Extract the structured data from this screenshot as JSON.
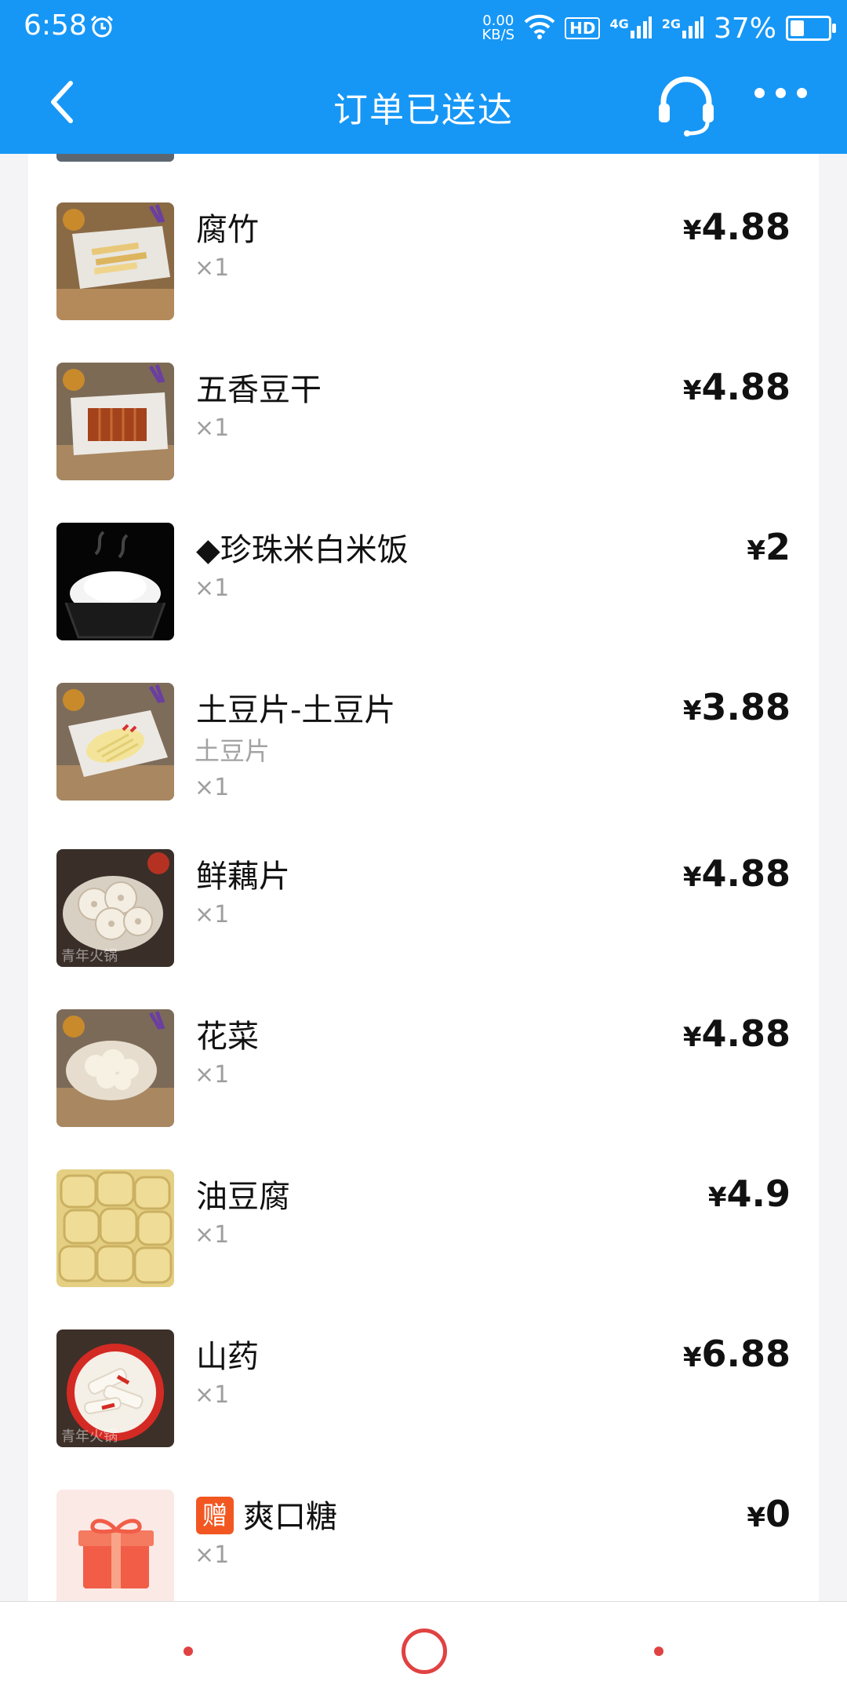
{
  "status": {
    "time": "6:58",
    "net_speed": "0.00",
    "net_unit": "KB/S",
    "hd": "HD",
    "sig1": "4G",
    "sig2": "2G",
    "battery": "37%",
    "battery_level": 0.37
  },
  "nav": {
    "title": "订单已送达"
  },
  "currency": "¥",
  "items": [
    {
      "name": "腐竹",
      "qty": "×1",
      "price": "4.88",
      "thumb_icon": "yuba-plate"
    },
    {
      "name": "五香豆干",
      "qty": "×1",
      "price": "4.88",
      "thumb_icon": "dried-tofu-plate"
    },
    {
      "name": "◆珍珠米白米饭",
      "qty": "×1",
      "price": "2",
      "thumb_icon": "rice-bowl"
    },
    {
      "name": "土豆片-土豆片",
      "spec": "土豆片",
      "qty": "×1",
      "price": "3.88",
      "thumb_icon": "potato-slices"
    },
    {
      "name": "鲜藕片",
      "qty": "×1",
      "price": "4.88",
      "thumb_icon": "lotus-root-plate",
      "watermark": "青年火锅"
    },
    {
      "name": "花菜",
      "qty": "×1",
      "price": "4.88",
      "thumb_icon": "cauliflower-bowl"
    },
    {
      "name": "油豆腐",
      "qty": "×1",
      "price": "4.9",
      "thumb_icon": "fried-tofu"
    },
    {
      "name": "山药",
      "qty": "×1",
      "price": "6.88",
      "thumb_icon": "yam-bowl",
      "watermark": "青年火锅"
    },
    {
      "badge": "赠",
      "name": "爽口糖",
      "qty": "×1",
      "price": "0",
      "thumb_icon": "gift-box"
    }
  ],
  "colors": {
    "header": "#1697f6",
    "badge": "#f25722",
    "nav_accent": "#e04242"
  }
}
